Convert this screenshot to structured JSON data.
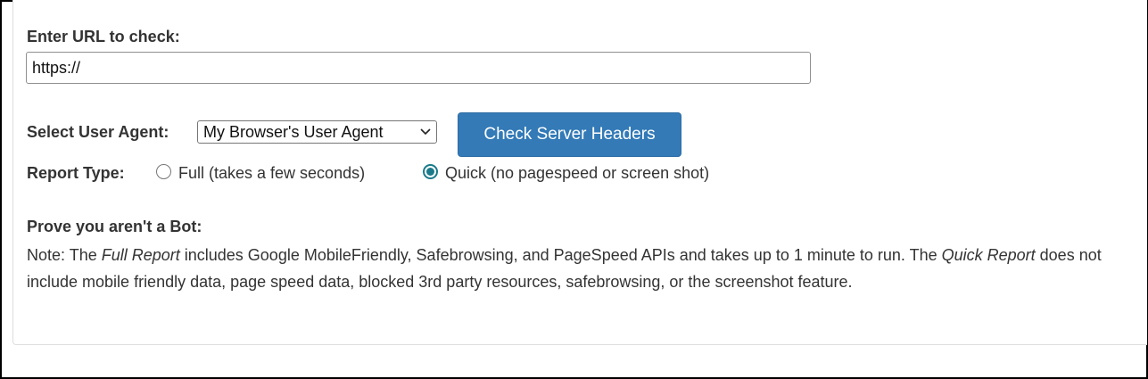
{
  "form": {
    "url_label": "Enter URL to check:",
    "url_value": "https://",
    "ua_label": "Select User Agent:",
    "ua_selected": "My Browser's User Agent",
    "submit_label": "Check Server Headers",
    "report_type_label": "Report Type:",
    "report_options": [
      {
        "label": "Full (takes a few seconds)",
        "selected": false
      },
      {
        "label": "Quick (no pagespeed or screen shot)",
        "selected": true
      }
    ]
  },
  "bot": {
    "title": "Prove you aren't a Bot:",
    "note_prefix": "Note: The ",
    "full_report": "Full Report",
    "note_mid": " includes Google MobileFriendly, Safebrowsing, and PageSpeed APIs and takes up to 1 minute to run. The ",
    "quick_report": "Quick Report",
    "note_suffix": " does not include mobile friendly data, page speed data, blocked 3rd party resources, safebrowsing, or the screenshot feature."
  },
  "colors": {
    "button_bg": "#337ab7",
    "radio_accent": "#1a7a8a"
  },
  "icons": {
    "select_arrow": "chevron-down-icon"
  }
}
